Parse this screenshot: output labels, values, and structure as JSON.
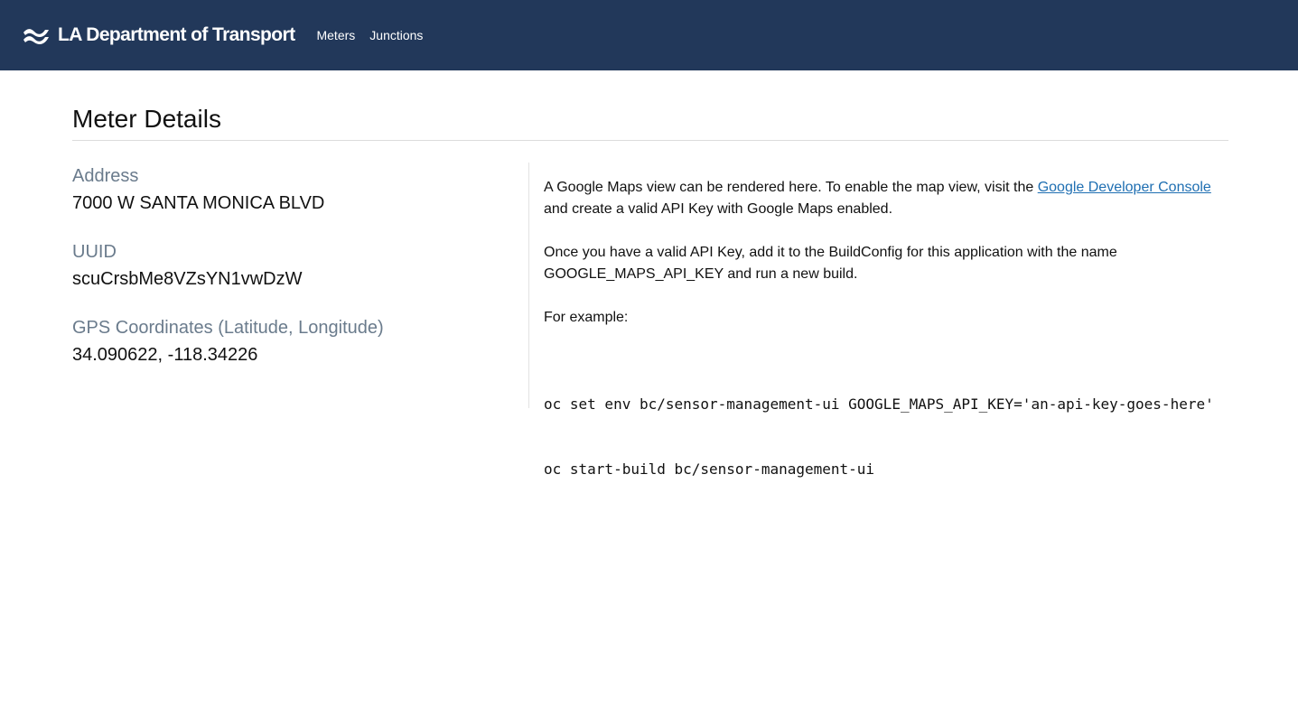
{
  "navbar": {
    "brand_name": "LA Department of Transport",
    "brand_icon": "wave-logo-icon",
    "links": [
      {
        "label": "Meters"
      },
      {
        "label": "Junctions"
      }
    ],
    "background_color": "#22385a"
  },
  "page": {
    "title": "Meter Details"
  },
  "details": {
    "address_label": "Address",
    "address_value": "7000 W SANTA MONICA BLVD",
    "uuid_label": "UUID",
    "uuid_value": "scuCrsbMe8VZsYN1vwDzW",
    "gps_label": "GPS Coordinates (Latitude, Longitude)",
    "gps_value": "34.090622, -118.34226"
  },
  "map_notice": {
    "intro_before_link": "A Google Maps view can be rendered here. To enable the map view, visit the ",
    "link_text": "Google Developer Console",
    "intro_after_link": " and create a valid API Key with Google Maps enabled.",
    "paragraph2": "Once you have a valid API Key, add it to the BuildConfig for this application with the name GOOGLE_MAPS_API_KEY and run a new build.",
    "paragraph3": "For example:",
    "code_line1": "oc set env bc/sensor-management-ui GOOGLE_MAPS_API_KEY='an-api-key-goes-here'",
    "code_line2": "oc start-build bc/sensor-management-ui",
    "link_color": "#1f6fb2"
  }
}
